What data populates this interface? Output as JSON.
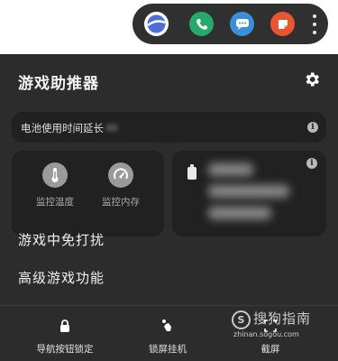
{
  "dock": {
    "apps": [
      {
        "name": "browser-app-icon",
        "color": "#3d6fd6"
      },
      {
        "name": "phone-app-icon",
        "color": "#27a96b"
      },
      {
        "name": "messages-app-icon",
        "color": "#3a8fd9"
      },
      {
        "name": "notes-app-icon",
        "color": "#e8552e"
      }
    ],
    "more_icon": "vertical-ellipsis-icon"
  },
  "panel": {
    "title": "游戏助推器",
    "settings_icon": "gear-icon",
    "battery_text": "电池使用时间延长",
    "monitor": [
      {
        "label": "监控温度",
        "icon": "thermometer-icon"
      },
      {
        "label": "监控内存",
        "icon": "speedometer-icon"
      }
    ],
    "menu": [
      "游戏中免打扰",
      "高级游戏功能"
    ],
    "toolbar": [
      {
        "label": "导航按钮锁定",
        "icon": "lock-icon"
      },
      {
        "label": "锁屏挂机",
        "icon": "touch-icon"
      },
      {
        "label": "截屏",
        "icon": "screenshot-icon"
      }
    ]
  },
  "watermark": {
    "logo": "S",
    "text": "搜狗指南",
    "url": "zhinan.sogou.com"
  }
}
